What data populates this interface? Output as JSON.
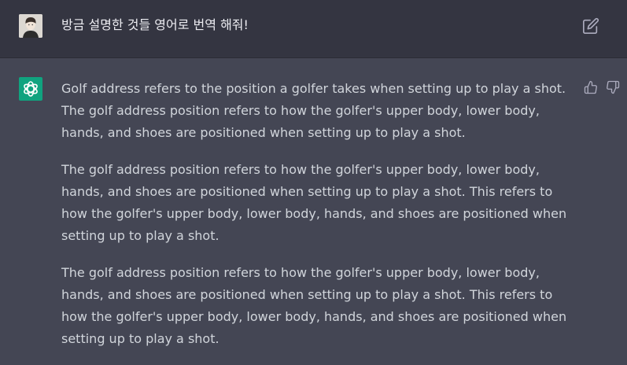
{
  "user_message": {
    "text": "방금 설명한 것들 영어로 번역 해줘!"
  },
  "assistant_message": {
    "paragraphs": [
      "Golf address refers to the position a golfer takes when setting up to play a shot. The golf address position refers to how the golfer's upper body, lower body, hands, and shoes are positioned when setting up to play a shot.",
      "The golf address position refers to how the golfer's upper body, lower body, hands, and shoes are positioned when setting up to play a shot. This refers to how the golfer's upper body, lower body, hands, and shoes are positioned when setting up to play a shot.",
      "The golf address position refers to how the golfer's upper body, lower body, hands, and shoes are positioned when setting up to play a shot. This refers to how the golfer's upper body, lower body, hands, and shoes are positioned when setting up to play a shot."
    ]
  },
  "icons": {
    "edit": "edit-icon",
    "thumbs_up": "thumbs-up-icon",
    "thumbs_down": "thumbs-down-icon",
    "assistant_logo": "openai-logo-icon"
  },
  "colors": {
    "user_row_bg": "#343541",
    "assistant_row_bg": "#444654",
    "assistant_avatar_bg": "#10a37f",
    "text": "#d1d5db"
  }
}
